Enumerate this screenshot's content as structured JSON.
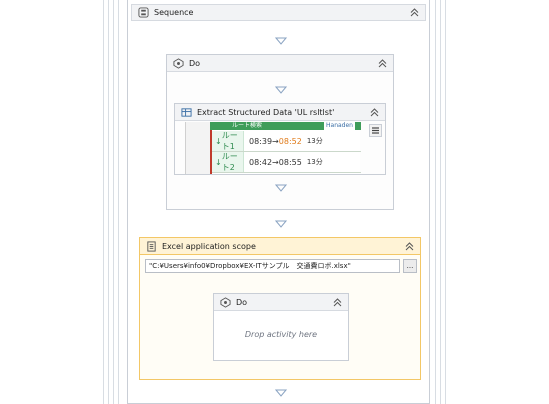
{
  "sequence": {
    "title": "Sequence"
  },
  "do_outer": {
    "title": "Do"
  },
  "extract": {
    "title": "Extract Structured Data 'UL  rsltlst'",
    "preview": {
      "header_text": "ルート検索",
      "header_badge": "Hanaden",
      "rows": [
        {
          "label": "ルート1",
          "depart": "08:39→",
          "arrive": "08:52",
          "duration": "13分"
        },
        {
          "label": "ルート2",
          "depart": "08:42→08:55",
          "arrive": "",
          "duration": "13分"
        }
      ]
    }
  },
  "excel": {
    "title": "Excel application scope",
    "path_value": "\"C:¥Users¥info0¥Dropbox¥EX-ITサンプル　交通費ロボ.xlsx\"",
    "browse_label": "..."
  },
  "do_inner": {
    "title": "Do",
    "drop_text": "Drop activity here"
  },
  "colors": {
    "accent_yellow": "#f3c766",
    "header_gray": "#f2f3f5",
    "route_green": "#2e8b4f",
    "time_orange": "#e07b1a"
  }
}
